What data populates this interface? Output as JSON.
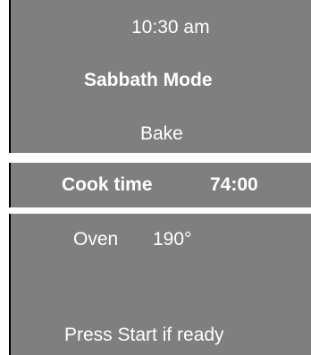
{
  "status": {
    "time": "10:30 am",
    "mode": "Sabbath Mode",
    "function": "Bake"
  },
  "cook_time": {
    "label": "Cook time",
    "value": "74:00"
  },
  "oven": {
    "label": "Oven",
    "temperature": "190°"
  },
  "prompt": "Press Start if ready",
  "colors": {
    "panel_background": "#7f7f7f",
    "text": "#ffffff"
  }
}
